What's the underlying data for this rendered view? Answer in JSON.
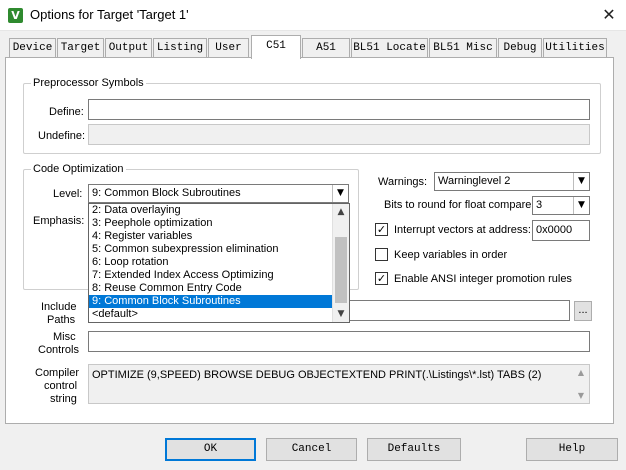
{
  "window": {
    "title": "Options for Target 'Target 1'",
    "icon": "keil-uvision-icon",
    "close_glyph": "✕"
  },
  "tabs": [
    {
      "label": "Device"
    },
    {
      "label": "Target"
    },
    {
      "label": "Output"
    },
    {
      "label": "Listing"
    },
    {
      "label": "User"
    },
    {
      "label": "C51",
      "active": true
    },
    {
      "label": "A51"
    },
    {
      "label": "BL51 Locate"
    },
    {
      "label": "BL51 Misc"
    },
    {
      "label": "Debug"
    },
    {
      "label": "Utilities"
    }
  ],
  "preprocessor": {
    "title": "Preprocessor Symbols",
    "define_label": "Define:",
    "define_value": "",
    "undefine_label": "Undefine:",
    "undefine_value": ""
  },
  "code_optimization": {
    "title": "Code Optimization",
    "level_label": "Level:",
    "level_value": "9: Common Block Subroutines",
    "emphasis_label": "Emphasis:",
    "level_options": [
      "2: Data overlaying",
      "3: Peephole optimization",
      "4: Register variables",
      "5: Common subexpression elimination",
      "6: Loop rotation",
      "7: Extended Index Access Optimizing",
      "8: Reuse Common Entry Code",
      "9: Common Block Subroutines",
      "<default>"
    ],
    "selected_index": 7
  },
  "warnings": {
    "label": "Warnings:",
    "value": "Warninglevel 2"
  },
  "float_bits": {
    "label": "Bits to round for float compare:",
    "value": "3"
  },
  "options": {
    "interrupt_vectors": {
      "label": "Interrupt vectors at address:",
      "checked": true,
      "address": "0x0000"
    },
    "keep_variables": {
      "label": "Keep variables in order",
      "checked": false
    },
    "ansi_integer": {
      "label": "Enable ANSI integer promotion rules",
      "checked": true
    }
  },
  "include_paths": {
    "label_line1": "Include",
    "label_line2": "Paths",
    "value": "",
    "browse_label": "..."
  },
  "misc_controls": {
    "label_line1": "Misc",
    "label_line2": "Controls",
    "value": ""
  },
  "compiler_string": {
    "label_line1": "Compiler",
    "label_line2": "control",
    "label_line3": "string",
    "value": "OPTIMIZE (9,SPEED) BROWSE DEBUG OBJECTEXTEND PRINT(.\\Listings\\*.lst) TABS (2)"
  },
  "buttons": {
    "ok": "OK",
    "cancel": "Cancel",
    "defaults": "Defaults",
    "help": "Help"
  },
  "glyphs": {
    "check": "✓",
    "arrow_down": "▼",
    "arrow_up": "▲"
  }
}
